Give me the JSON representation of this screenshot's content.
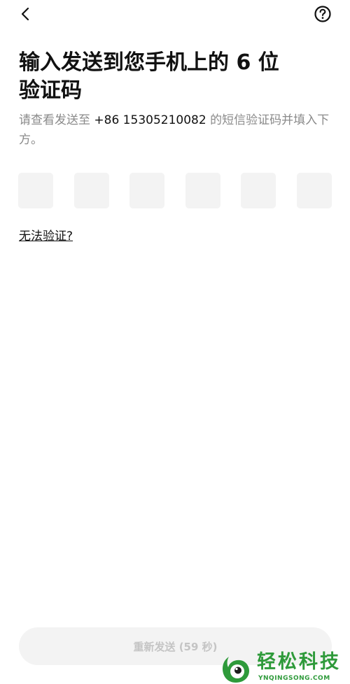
{
  "header": {
    "back_icon": "chevron-left-icon",
    "help_icon": "question-circle-icon"
  },
  "title": {
    "line1": "输入发送到您手机上的 6 位",
    "line2": "验证码"
  },
  "subtitle": {
    "prefix": "请查看发送至 ",
    "phone": "+86 15305210082",
    "suffix": " 的短信验证码并填入下方。"
  },
  "code_input": {
    "length": 6,
    "values": [
      "",
      "",
      "",
      "",
      "",
      ""
    ]
  },
  "cant_verify_label": "无法验证?",
  "resend_label": "重新发送 (59 秒)",
  "watermark": {
    "name": "轻松科技",
    "url": "YNQINGSONG.COM"
  },
  "colors": {
    "background": "#ffffff",
    "text_primary": "#111111",
    "text_secondary": "#8a8a8a",
    "input_bg": "#f3f3f3",
    "button_disabled_text": "#c4c4c4",
    "watermark_green": "#2e9a3a"
  }
}
